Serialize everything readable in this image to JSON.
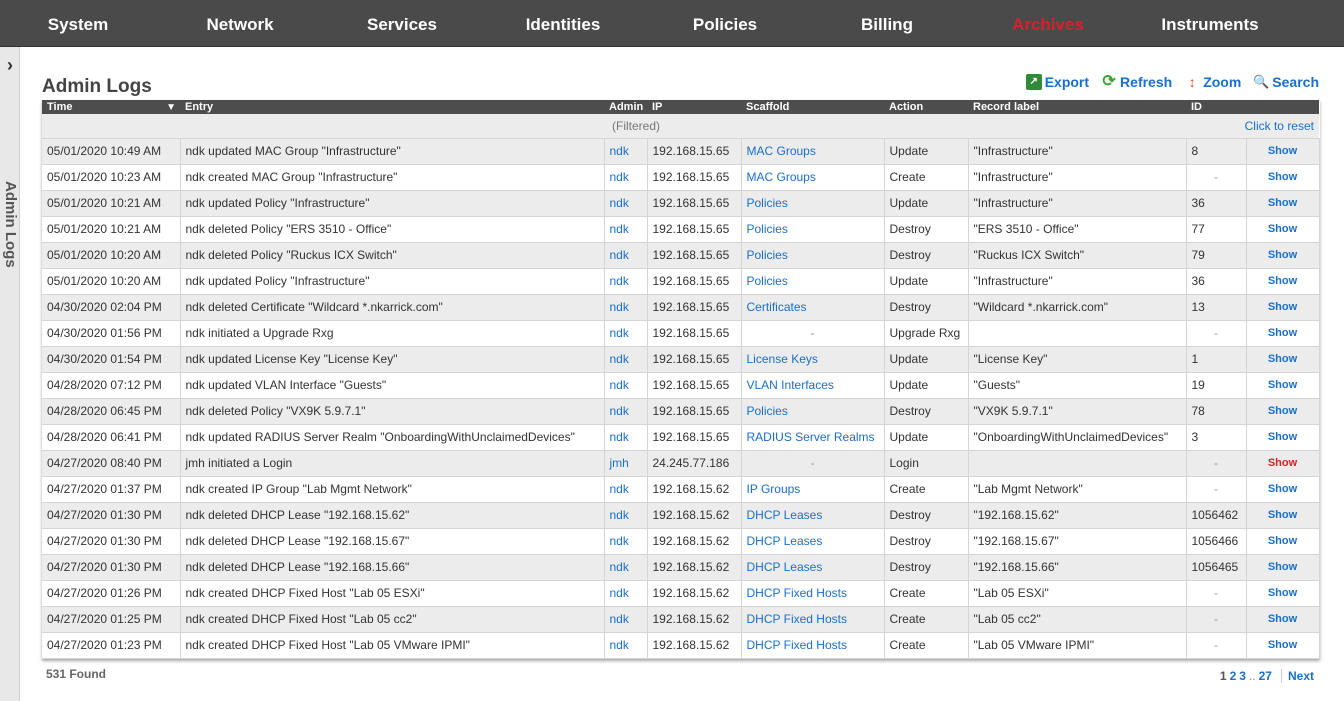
{
  "nav": [
    "System",
    "Network",
    "Services",
    "Identities",
    "Policies",
    "Billing",
    "Archives",
    "Instruments"
  ],
  "sidebar": {
    "toggle_icon": "›",
    "label": "Admin Logs"
  },
  "page_title": "Admin Logs",
  "toolbar": {
    "export": "Export",
    "refresh": "Refresh",
    "zoom": "Zoom",
    "search": "Search"
  },
  "columns": [
    "Time",
    "Entry",
    "Admin",
    "IP",
    "Scaffold",
    "Action",
    "Record label",
    "ID",
    ""
  ],
  "filter": {
    "text": "(Filtered)",
    "reset": "Click to reset"
  },
  "rows": [
    {
      "time": "05/01/2020 10:49 AM",
      "entry": "ndk updated MAC Group \"Infrastructure\"",
      "admin": "ndk",
      "ip": "192.168.15.65",
      "scaffold": "MAC Groups",
      "action": "Update",
      "label": "\"Infrastructure\"",
      "id": "8",
      "show": "Show"
    },
    {
      "time": "05/01/2020 10:23 AM",
      "entry": "ndk created MAC Group \"Infrastructure\"",
      "admin": "ndk",
      "ip": "192.168.15.65",
      "scaffold": "MAC Groups",
      "action": "Create",
      "label": "\"Infrastructure\"",
      "id": "-",
      "show": "Show"
    },
    {
      "time": "05/01/2020 10:21 AM",
      "entry": "ndk updated Policy \"Infrastructure\"",
      "admin": "ndk",
      "ip": "192.168.15.65",
      "scaffold": "Policies",
      "action": "Update",
      "label": "\"Infrastructure\"",
      "id": "36",
      "show": "Show"
    },
    {
      "time": "05/01/2020 10:21 AM",
      "entry": "ndk deleted Policy \"ERS 3510 - Office\"",
      "admin": "ndk",
      "ip": "192.168.15.65",
      "scaffold": "Policies",
      "action": "Destroy",
      "label": "\"ERS 3510 - Office\"",
      "id": "77",
      "show": "Show"
    },
    {
      "time": "05/01/2020 10:20 AM",
      "entry": "ndk deleted Policy \"Ruckus ICX Switch\"",
      "admin": "ndk",
      "ip": "192.168.15.65",
      "scaffold": "Policies",
      "action": "Destroy",
      "label": "\"Ruckus ICX Switch\"",
      "id": "79",
      "show": "Show"
    },
    {
      "time": "05/01/2020 10:20 AM",
      "entry": "ndk updated Policy \"Infrastructure\"",
      "admin": "ndk",
      "ip": "192.168.15.65",
      "scaffold": "Policies",
      "action": "Update",
      "label": "\"Infrastructure\"",
      "id": "36",
      "show": "Show"
    },
    {
      "time": "04/30/2020 02:04 PM",
      "entry": "ndk deleted Certificate \"Wildcard *.nkarrick.com\"",
      "admin": "ndk",
      "ip": "192.168.15.65",
      "scaffold": "Certificates",
      "action": "Destroy",
      "label": "\"Wildcard *.nkarrick.com\"",
      "id": "13",
      "show": "Show"
    },
    {
      "time": "04/30/2020 01:56 PM",
      "entry": "ndk initiated a Upgrade Rxg",
      "admin": "ndk",
      "ip": "192.168.15.65",
      "scaffold": "-",
      "action": "Upgrade Rxg",
      "label": "",
      "id": "-",
      "show": "Show"
    },
    {
      "time": "04/30/2020 01:54 PM",
      "entry": "ndk updated License Key \"License Key\"",
      "admin": "ndk",
      "ip": "192.168.15.65",
      "scaffold": "License Keys",
      "action": "Update",
      "label": "\"License Key\"",
      "id": "1",
      "show": "Show"
    },
    {
      "time": "04/28/2020 07:12 PM",
      "entry": "ndk updated VLAN Interface \"Guests\"",
      "admin": "ndk",
      "ip": "192.168.15.65",
      "scaffold": "VLAN Interfaces",
      "action": "Update",
      "label": "\"Guests\"",
      "id": "19",
      "show": "Show"
    },
    {
      "time": "04/28/2020 06:45 PM",
      "entry": "ndk deleted Policy \"VX9K 5.9.7.1\"",
      "admin": "ndk",
      "ip": "192.168.15.65",
      "scaffold": "Policies",
      "action": "Destroy",
      "label": "\"VX9K 5.9.7.1\"",
      "id": "78",
      "show": "Show"
    },
    {
      "time": "04/28/2020 06:41 PM",
      "entry": "ndk updated RADIUS Server Realm \"OnboardingWithUnclaimedDevices\"",
      "admin": "ndk",
      "ip": "192.168.15.65",
      "scaffold": "RADIUS Server Realms",
      "action": "Update",
      "label": "\"OnboardingWithUnclaimedDevices\"",
      "id": "3",
      "show": "Show"
    },
    {
      "time": "04/27/2020 08:40 PM",
      "entry": "jmh initiated a Login",
      "admin": "jmh",
      "ip": "24.245.77.186",
      "scaffold": "-",
      "action": "Login",
      "label": "",
      "id": "-",
      "show": "Show"
    },
    {
      "time": "04/27/2020 01:37 PM",
      "entry": "ndk created IP Group \"Lab Mgmt Network\"",
      "admin": "ndk",
      "ip": "192.168.15.62",
      "scaffold": "IP Groups",
      "action": "Create",
      "label": "\"Lab Mgmt Network\"",
      "id": "-",
      "show": "Show"
    },
    {
      "time": "04/27/2020 01:30 PM",
      "entry": "ndk deleted DHCP Lease \"192.168.15.62\"",
      "admin": "ndk",
      "ip": "192.168.15.62",
      "scaffold": "DHCP Leases",
      "action": "Destroy",
      "label": "\"192.168.15.62\"",
      "id": "1056462",
      "show": "Show"
    },
    {
      "time": "04/27/2020 01:30 PM",
      "entry": "ndk deleted DHCP Lease \"192.168.15.67\"",
      "admin": "ndk",
      "ip": "192.168.15.62",
      "scaffold": "DHCP Leases",
      "action": "Destroy",
      "label": "\"192.168.15.67\"",
      "id": "1056466",
      "show": "Show"
    },
    {
      "time": "04/27/2020 01:30 PM",
      "entry": "ndk deleted DHCP Lease \"192.168.15.66\"",
      "admin": "ndk",
      "ip": "192.168.15.62",
      "scaffold": "DHCP Leases",
      "action": "Destroy",
      "label": "\"192.168.15.66\"",
      "id": "1056465",
      "show": "Show"
    },
    {
      "time": "04/27/2020 01:26 PM",
      "entry": "ndk created DHCP Fixed Host \"Lab 05 ESXi\"",
      "admin": "ndk",
      "ip": "192.168.15.62",
      "scaffold": "DHCP Fixed Hosts",
      "action": "Create",
      "label": "\"Lab 05 ESXi\"",
      "id": "-",
      "show": "Show"
    },
    {
      "time": "04/27/2020 01:25 PM",
      "entry": "ndk created DHCP Fixed Host \"Lab 05 cc2\"",
      "admin": "ndk",
      "ip": "192.168.15.62",
      "scaffold": "DHCP Fixed Hosts",
      "action": "Create",
      "label": "\"Lab 05 cc2\"",
      "id": "-",
      "show": "Show"
    },
    {
      "time": "04/27/2020 01:23 PM",
      "entry": "ndk created DHCP Fixed Host \"Lab 05 VMware IPMI\"",
      "admin": "ndk",
      "ip": "192.168.15.62",
      "scaffold": "DHCP Fixed Hosts",
      "action": "Create",
      "label": "\"Lab 05 VMware IPMI\"",
      "id": "-",
      "show": "Show"
    }
  ],
  "found": "531 Found",
  "pager": {
    "pages": [
      "1",
      "2",
      "3"
    ],
    "ellipsis": "..",
    "last": "27",
    "next": "Next"
  },
  "colors": {
    "nav_bg": "#4a4a4a",
    "nav_active": "#d8202a",
    "link": "#1a6fc9",
    "show_highlight": "#d8202a"
  },
  "highlight_show_row": 12
}
